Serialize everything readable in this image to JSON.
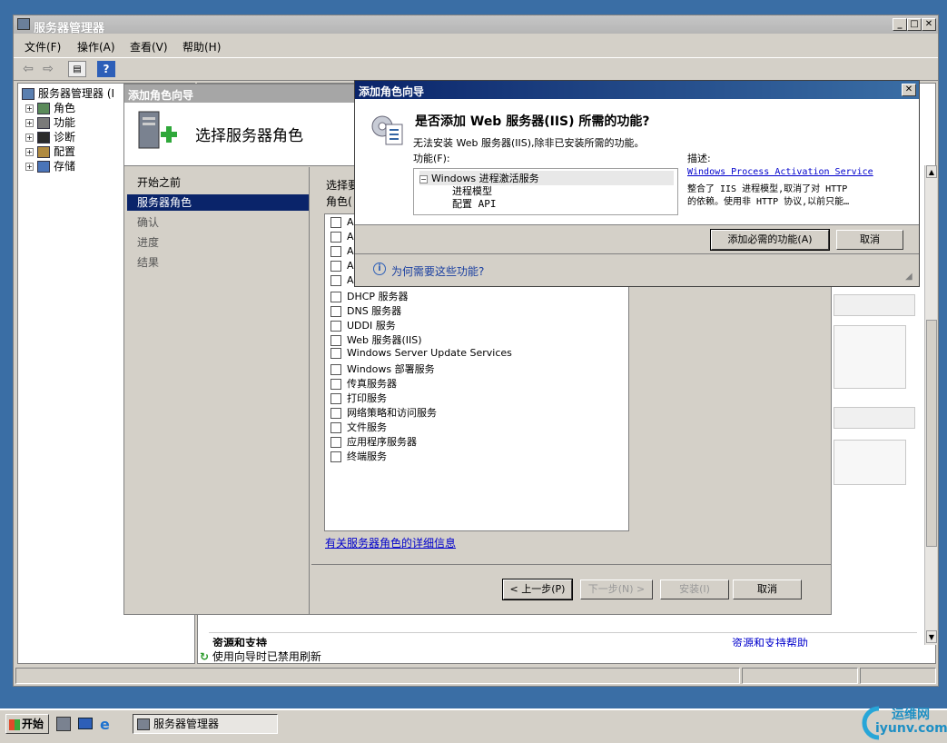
{
  "main_window": {
    "title": "服务器管理器",
    "controls": {
      "minimize": "_",
      "maximize": "□",
      "close": "✕"
    },
    "menu": [
      "文件(F)",
      "操作(A)",
      "查看(V)",
      "帮助(H)"
    ],
    "tree": {
      "root": "服务器管理器 (I",
      "items": [
        "角色",
        "功能",
        "诊断",
        "配置",
        "存储"
      ]
    },
    "right_pane": {
      "section_bottom_left": "资源和支持",
      "section_bottom_right": "资源和支持帮助"
    },
    "status": "使用向导时已禁用刷新"
  },
  "wizard": {
    "title": "添加角色向导",
    "heading": "选择服务器角色",
    "nav": [
      "开始之前",
      "服务器角色",
      "确认",
      "进度",
      "结果"
    ],
    "intro_line1": "选择要",
    "intro_line2": "角色(",
    "roles": [
      "A",
      "A",
      "A",
      "A",
      "A",
      "DHCP 服务器",
      "DNS 服务器",
      "UDDI 服务",
      "Web 服务器(IIS)",
      "Windows Server Update Services",
      "Windows 部署服务",
      "传真服务器",
      "打印服务",
      "网络策略和访问服务",
      "文件服务",
      "应用程序服务器",
      "终端服务"
    ],
    "more_info_link": "有关服务器角色的详细信息",
    "buttons": {
      "back": "< 上一步(P)",
      "next": "下一步(N) >",
      "install": "安装(I)",
      "cancel": "取消"
    }
  },
  "dialog": {
    "title": "添加角色向导",
    "question": "是否添加 Web 服务器(IIS) 所需的功能?",
    "explanation": "无法安装 Web 服务器(IIS),除非已安装所需的功能。",
    "features_label": "功能(F):",
    "features_tree": {
      "parent": "Windows 进程激活服务",
      "children": [
        "进程模型",
        "配置 API"
      ]
    },
    "description_label": "描述:",
    "description_link": "Windows Process Activation Service",
    "description_line1": "整合了 IIS 进程模型,取消了对 HTTP",
    "description_line2": "的依赖。使用非 HTTP 协议,以前只能…",
    "add_button": "添加必需的功能(A)",
    "cancel_button": "取消",
    "help_link": "为何需要这些功能?"
  },
  "taskbar": {
    "start": "开始",
    "task": "服务器管理器"
  },
  "watermark": {
    "line1": "运维网",
    "line2": "iyunv.com"
  },
  "colors": {
    "desktop": "#3a6ea5",
    "dialog_title": "#0a246a",
    "selection": "#0a246a",
    "link": "#0000cc"
  }
}
